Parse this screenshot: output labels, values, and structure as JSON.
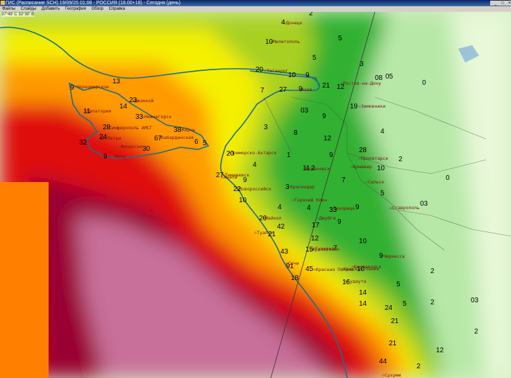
{
  "window": {
    "title": "ГИС (Расписание SCH) 19/09/25 01:08 - РОССИЯ (18.00+18) - Сегодня (день)",
    "buttons": [
      "_",
      "□",
      "×"
    ]
  },
  "menu": [
    "Файлы",
    "Слайды",
    "Добавить",
    "География",
    "Обзор",
    "Справка"
  ],
  "coordinate_readout": "37°49' С 32°30' В",
  "cities": [
    "Донецк",
    "Мелитополь",
    "Таганрог",
    "Азов",
    "Ростов-на-Дону",
    "Черноморское",
    "Евпатория",
    "Джанкой",
    "Нижнегорск",
    "Симферополь АМСГ",
    "Феодосия",
    "Керчь",
    "Кабардинская",
    "Ай-Петри",
    "Ялта",
    "Приморско-Ахтарск",
    "Тимашевск",
    "Кореновск",
    "Краснодар",
    "Анапа",
    "Новороссийск",
    "Горячий Ключ",
    "Джубга",
    "Майкоп",
    "Туапсе",
    "Гузерипль",
    "Сочи",
    "Красная Поляна",
    "Кисловодск",
    "Гудаута",
    "Сухуми",
    "Красная Пахня",
    "Тихорецк",
    "Ставрополь",
    "Армавир",
    "Черкесск",
    "Сальск",
    "Кропоткин",
    "Зимовники",
    "Пролетарск"
  ],
  "values": [
    "4",
    "2",
    "5",
    "10",
    "5",
    "3",
    "20",
    "10",
    "9",
    "21",
    "12",
    "08",
    "05",
    "0",
    "9",
    "13",
    "7",
    "27",
    "9",
    "23",
    "14",
    "03",
    "9",
    "19",
    "11",
    "33",
    "4",
    "38",
    "28",
    "8",
    "3",
    "12",
    "6",
    "24",
    "67",
    "5",
    "30",
    "32",
    "9",
    "20",
    "1",
    "28",
    "9",
    "10",
    "2",
    "4",
    "11",
    "2",
    "7",
    "0",
    "27",
    "9",
    "3",
    "5",
    "22",
    "03",
    "10",
    "4",
    "33",
    "9",
    "26",
    "4",
    "9",
    "42",
    "17",
    "21",
    "12",
    "10",
    "15",
    "43",
    "7",
    "9",
    "91",
    "45",
    "10",
    "18",
    "16",
    "5",
    "2",
    "14",
    "14",
    "24",
    "5",
    "2",
    "03",
    "21",
    "2",
    "21",
    "12",
    "44",
    "2"
  ],
  "colors": {
    "low": "#e6f7d8",
    "green": "#22b030",
    "yellow": "#f5f000",
    "orange": "#ff9a00",
    "red": "#e01010",
    "maroon": "#8a0030",
    "pink": "#c8709a",
    "coast": "#1a6e8a"
  }
}
